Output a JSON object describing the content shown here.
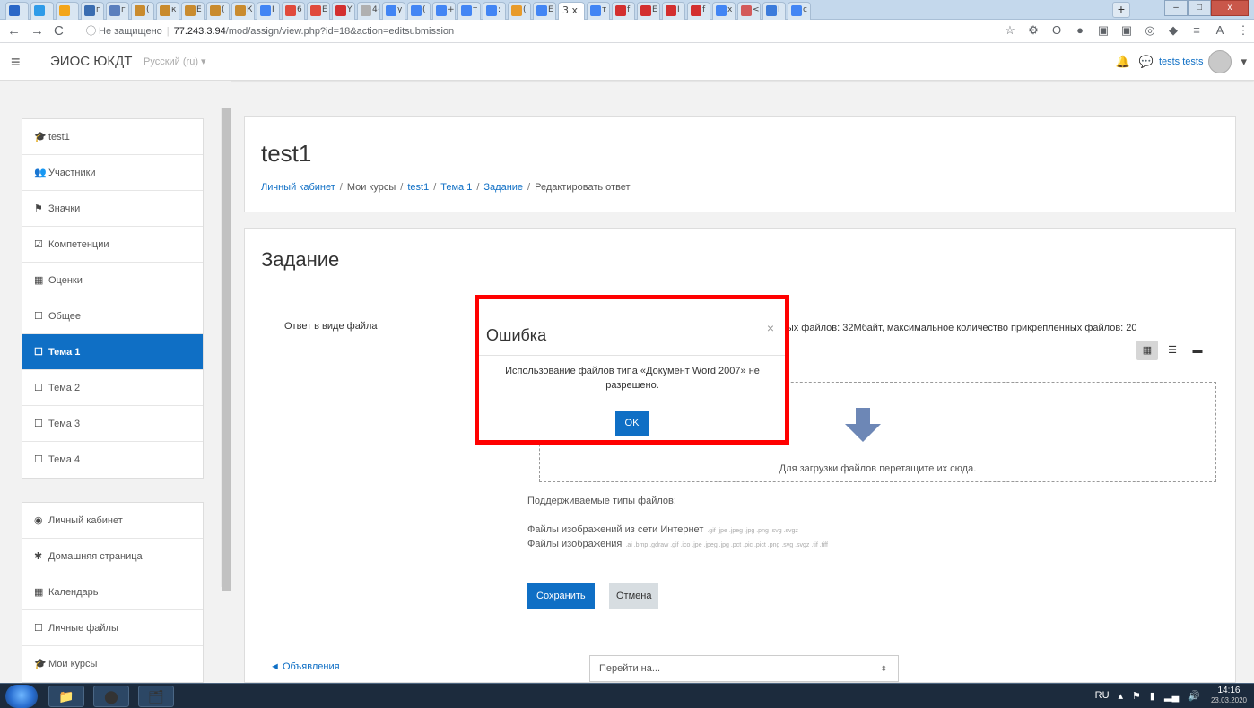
{
  "browser": {
    "tabs": [
      {
        "label": "",
        "color": "#2a67c7"
      },
      {
        "label": "",
        "color": "#2e9be8"
      },
      {
        "label": "",
        "color": "#f3a51a"
      },
      {
        "label": "г",
        "color": "#3a6db1"
      },
      {
        "label": "г",
        "color": "#5b7fbd"
      },
      {
        "label": "(",
        "color": "#c98b2e"
      },
      {
        "label": "к",
        "color": "#c98b2e"
      },
      {
        "label": "Е",
        "color": "#c98b2e"
      },
      {
        "label": "(",
        "color": "#c98b2e"
      },
      {
        "label": "К",
        "color": "#c98b2e"
      },
      {
        "label": "I",
        "color": "#4285f4"
      },
      {
        "label": "6",
        "color": "#e04a3c"
      },
      {
        "label": "Е",
        "color": "#e04a3c"
      },
      {
        "label": "Y",
        "color": "#d32f2f"
      },
      {
        "label": "4+",
        "color": "#b0b0b0"
      },
      {
        "label": "y",
        "color": "#4285f4"
      },
      {
        "label": "(",
        "color": "#4285f4"
      },
      {
        "label": "+",
        "color": "#4285f4"
      },
      {
        "label": "т",
        "color": "#4285f4"
      },
      {
        "label": ":",
        "color": "#4285f4"
      },
      {
        "label": "(",
        "color": "#e89b2b"
      },
      {
        "label": "Е",
        "color": "#4285f4"
      },
      {
        "label": "3 x",
        "color": "#ffffff",
        "active": true
      },
      {
        "label": "т",
        "color": "#4285f4"
      },
      {
        "label": "f",
        "color": "#d32f2f"
      },
      {
        "label": "Е",
        "color": "#d32f2f"
      },
      {
        "label": "I",
        "color": "#d32f2f"
      },
      {
        "label": "f",
        "color": "#d32f2f"
      },
      {
        "label": "х",
        "color": "#4285f4"
      },
      {
        "label": "<",
        "color": "#d35a5a"
      },
      {
        "label": "I",
        "color": "#3b7bdb"
      },
      {
        "label": "с",
        "color": "#4285f4"
      }
    ],
    "new_tab_label": "+",
    "window_controls": {
      "minimize": "–",
      "maximize": "□",
      "close": "x"
    },
    "back_label": "←",
    "forward_label": "→",
    "reload_label": "C",
    "security_text": "ⓘ Не защищено",
    "url_host": "77.243.3.94",
    "url_path": "/mod/assign/view.php?id=18&action=editsubmission",
    "extensions": [
      "☆",
      "⚙",
      "O",
      "●",
      "▣",
      "▣",
      "◎",
      "◆",
      "≡",
      "A",
      "⋮"
    ]
  },
  "navbar": {
    "menu_icon": "≡",
    "site_name": "ЭИОС ЮКДТ",
    "language": "Русский (ru) ▾",
    "bell_icon": "🔔",
    "message_icon": "💬",
    "user_name": "tests tests",
    "user_caret": "▾"
  },
  "drawer": {
    "group1": [
      {
        "icon": "🎓",
        "label": "test1"
      },
      {
        "icon": "👥",
        "label": "Участники"
      },
      {
        "icon": "⚑",
        "label": "Значки"
      },
      {
        "icon": "☑",
        "label": "Компетенции"
      },
      {
        "icon": "▦",
        "label": "Оценки"
      },
      {
        "icon": "☐",
        "label": "Общее"
      },
      {
        "icon": "☐",
        "label": "Тема 1",
        "active": true
      },
      {
        "icon": "☐",
        "label": "Тема 2"
      },
      {
        "icon": "☐",
        "label": "Тема 3"
      },
      {
        "icon": "☐",
        "label": "Тема 4"
      }
    ],
    "group2": [
      {
        "icon": "◉",
        "label": "Личный кабинет"
      },
      {
        "icon": "✱",
        "label": "Домашняя страница"
      },
      {
        "icon": "▦",
        "label": "Календарь"
      },
      {
        "icon": "☐",
        "label": "Личные файлы"
      },
      {
        "icon": "🎓",
        "label": "Мои курсы"
      }
    ]
  },
  "header": {
    "title": "test1",
    "breadcrumb": [
      "Личный кабинет",
      "Мои курсы",
      "test1",
      "Тема 1",
      "Задание",
      "Редактировать ответ"
    ]
  },
  "main": {
    "section_title": "Задание",
    "field_label": "Ответ в виде файла",
    "limits_text": "вых файлов: 32Мбайт, максимальное количество прикрепленных файлов: 20",
    "view_icons": [
      "▦",
      "☰",
      "▬"
    ],
    "dropzone_text": "Для загрузки файлов перетащите их сюда.",
    "types_title": "Поддерживаемые типы файлов:",
    "types": [
      {
        "label": "Файлы изображений из сети Интернет",
        "extensions": ".gif .jpe .jpeg .jpg .png .svg .svgz"
      },
      {
        "label": "Файлы изображения",
        "extensions": ".ai .bmp .gdraw .gif .ico .jpe .jpeg .jpg .pct .pic .pict .png .svg .svgz .tif .tiff"
      }
    ],
    "save_label": "Сохранить",
    "cancel_label": "Отмена",
    "prev_link": "◄ Объявления",
    "jump_placeholder": "Перейти на...",
    "jump_caret": "⬍"
  },
  "modal": {
    "title": "Ошибка",
    "close_label": "×",
    "message": "Использование файлов типа «Документ Word 2007» не разрешено.",
    "ok_label": "OK",
    "highlight_color": "#ff0000"
  },
  "taskbar": {
    "apps": [
      "📁",
      "⬤",
      "🗂"
    ],
    "lang": "RU",
    "tray_icons": [
      "▴",
      "⚑",
      "▮",
      "▂▄",
      "🔊"
    ],
    "time": "14:16",
    "date": "23.03.2020"
  }
}
